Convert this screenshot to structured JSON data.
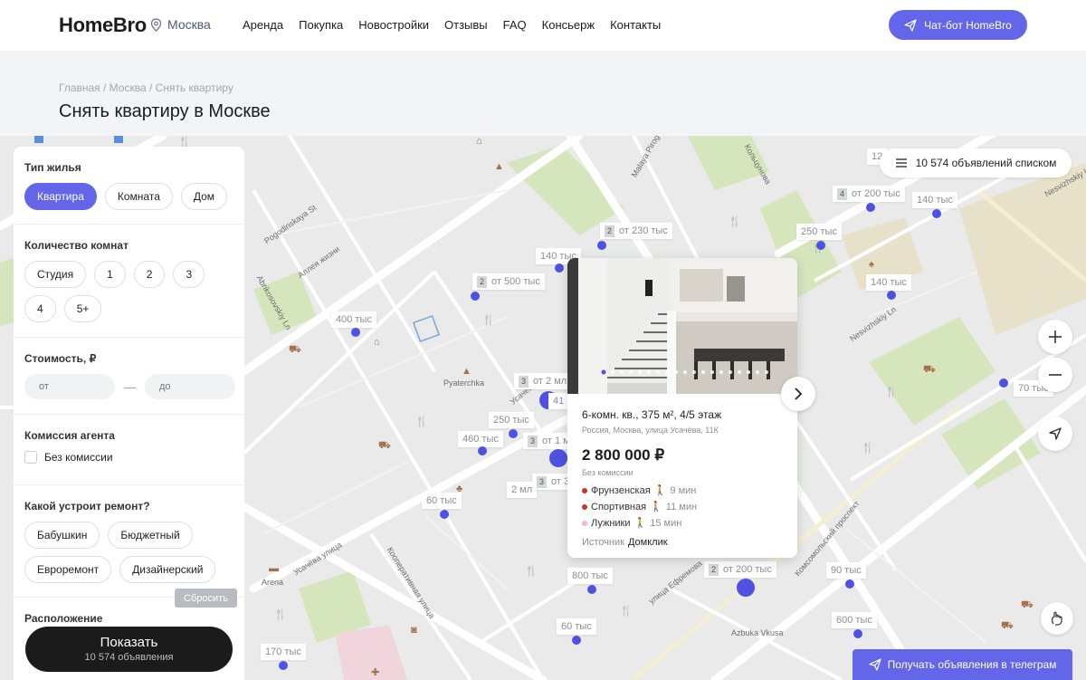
{
  "header": {
    "logo": "HomeBro",
    "city": "Москва",
    "nav": [
      "Аренда",
      "Покупка",
      "Новостройки",
      "Отзывы",
      "FAQ",
      "Консьерж",
      "Контакты"
    ],
    "chatbot_label": "Чат-бот HomeBro"
  },
  "breadcrumbs": "Главная / Москва / Снять квартиру",
  "page_title": "Снять квартиру в Москве",
  "filters": {
    "housing_type": {
      "title": "Тип жилья",
      "options": [
        "Квартира",
        "Комната",
        "Дом"
      ],
      "selected": "Квартира"
    },
    "rooms": {
      "title": "Количество комнат",
      "options": [
        "Студия",
        "1",
        "2",
        "3",
        "4",
        "5+"
      ]
    },
    "price": {
      "title": "Стоимость, ₽",
      "from_placeholder": "от",
      "to_placeholder": "до",
      "dash": "—"
    },
    "commission": {
      "title": "Комиссия агента",
      "checkbox_label": "Без комиссии"
    },
    "renovation": {
      "title": "Какой устроит ремонт?",
      "options": [
        "Бабушкин",
        "Бюджетный",
        "Евроремонт",
        "Дизайнерский"
      ]
    },
    "next_section_title": "Расположение",
    "reset_label": "Сбросить",
    "show_label": "Показать",
    "show_count": "10 574 объявления"
  },
  "map": {
    "list_button": "10 574 объявлений списком",
    "telegram_button": "Получать объявления в телеграм",
    "street_labels": [
      "Pogodinskaya St",
      "Аллея жизни",
      "Abrikosovskiy Ln",
      "Pyaterchka",
      "Malaya Pirog",
      "Кольцунова",
      "Nesvizhskiy Ln",
      "Усачёва улица",
      "Кооперативная улица",
      "улица Ефремова",
      "Комсомольский проспект",
      "Azbuka Vkusa",
      "Arena",
      "Nesvizhskiy Ln",
      "Усачёва"
    ],
    "pins": [
      {
        "price": "от 230 тыс",
        "count": "2"
      },
      {
        "price": "140 тыс"
      },
      {
        "price": "от 500 тыс",
        "count": "2"
      },
      {
        "price": "400 тыс"
      },
      {
        "price": "от 2 мл",
        "count": "3"
      },
      {
        "price": "250 тыс"
      },
      {
        "price": "460 тыс"
      },
      {
        "price": "от 1 м",
        "count": "3"
      },
      {
        "price": "от 3",
        "count": "3"
      },
      {
        "price": "2 мл"
      },
      {
        "price": "60 тыс"
      },
      {
        "price": "от 200 тыс",
        "count": "4"
      },
      {
        "price": "140 тыс"
      },
      {
        "price": "250 тыс"
      },
      {
        "price": "140 тыс"
      },
      {
        "price": "70 тыс"
      },
      {
        "price": "от 200 тыс",
        "count": "2"
      },
      {
        "price": "800 тыс"
      },
      {
        "price": "90 тыс"
      },
      {
        "price": "60 тыс"
      },
      {
        "price": "600 тыс"
      },
      {
        "price": "170 тыс"
      },
      {
        "price": "12"
      },
      {
        "price": "41"
      }
    ]
  },
  "card": {
    "title": "6-комн. кв., 375 м², 4/5 этаж",
    "address": "Россия, Москва, улица Усачёва, 11К",
    "price": "2 800 000 ₽",
    "commission": "Без комиссии",
    "metro": [
      {
        "name": "Фрунзенская",
        "time": "9 мин",
        "color": "#c0392b"
      },
      {
        "name": "Спортивная",
        "time": "11 мин",
        "color": "#c0392b"
      },
      {
        "name": "Лужники",
        "time": "15 мин",
        "color": "#f2b8c6"
      }
    ],
    "source_label": "Источник",
    "source_value": "Домклик"
  },
  "colors": {
    "accent": "#6366e8",
    "dark": "#1b1b1b",
    "map_bg": "#e9eae9",
    "park": "#cfe3b0"
  }
}
